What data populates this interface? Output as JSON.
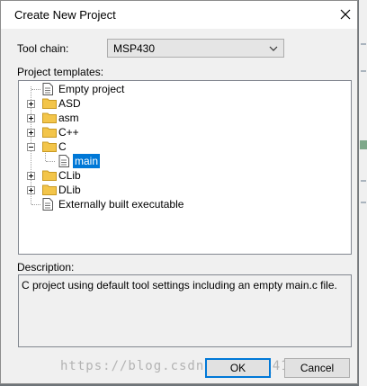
{
  "dialog": {
    "title": "Create New Project"
  },
  "toolchain": {
    "label": "Tool chain:",
    "value": "MSP430"
  },
  "templates": {
    "label": "Project templates:",
    "items": [
      {
        "label": "Empty project",
        "icon": "document-icon"
      },
      {
        "label": "ASD",
        "icon": "folder-icon",
        "expander": "plus"
      },
      {
        "label": "asm",
        "icon": "folder-icon",
        "expander": "plus"
      },
      {
        "label": "C++",
        "icon": "folder-icon",
        "expander": "plus"
      },
      {
        "label": "C",
        "icon": "folder-icon",
        "expander": "minus"
      },
      {
        "label": "main",
        "icon": "document-icon",
        "selected": true
      },
      {
        "label": "CLib",
        "icon": "folder-icon",
        "expander": "plus"
      },
      {
        "label": "DLib",
        "icon": "folder-icon",
        "expander": "plus"
      },
      {
        "label": "Externally built executable",
        "icon": "document-icon"
      }
    ]
  },
  "description": {
    "label": "Description:",
    "text": "C project using default tool settings including an empty main.c file."
  },
  "buttons": {
    "ok": "OK",
    "cancel": "Cancel"
  },
  "watermark": "https://blog.csdn.net/qq_41167652",
  "colors": {
    "selection": "#0078d7",
    "folder": "#f3c54a",
    "primary_border": "#0078d7"
  }
}
